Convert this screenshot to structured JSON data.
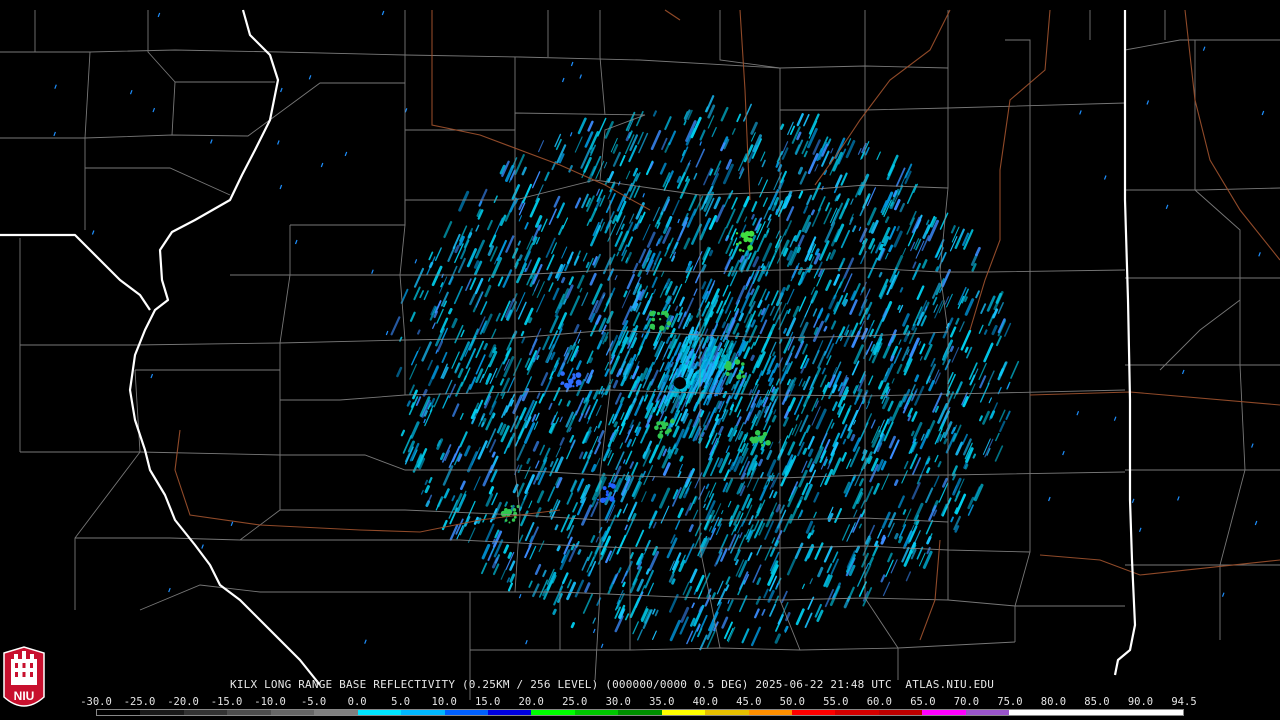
{
  "caption": "KILX LONG RANGE BASE REFLECTIVITY (0.25KM / 256 LEVEL) (000000/0000 0.5 DEG) 2025-06-22 21:48 UTC  ATLAS.NIU.EDU",
  "logo_text": "NIU",
  "radar": {
    "site": "KILX"
  },
  "colorbar": {
    "ticks": [
      "-30.0",
      "-25.0",
      "-20.0",
      "-15.0",
      "-10.0",
      "-5.0",
      "0.0",
      "5.0",
      "10.0",
      "15.0",
      "20.0",
      "25.0",
      "30.0",
      "35.0",
      "40.0",
      "45.0",
      "50.0",
      "55.0",
      "60.0",
      "65.0",
      "70.0",
      "75.0",
      "80.0",
      "85.0",
      "90.0",
      "94.5"
    ],
    "colors": [
      "#000000",
      "#1a1a1a",
      "#333333",
      "#4d4d4d",
      "#666666",
      "#7f7f7f",
      "#00e5ff",
      "#00b8ff",
      "#0060ff",
      "#0000e0",
      "#00ff00",
      "#00c800",
      "#009000",
      "#ffff00",
      "#e6c000",
      "#ff9000",
      "#ff0000",
      "#d40000",
      "#bc0000",
      "#ff00ff",
      "#9955c9",
      "#ffffff",
      "#ffffff",
      "#ffffff",
      "#ffffff"
    ]
  }
}
